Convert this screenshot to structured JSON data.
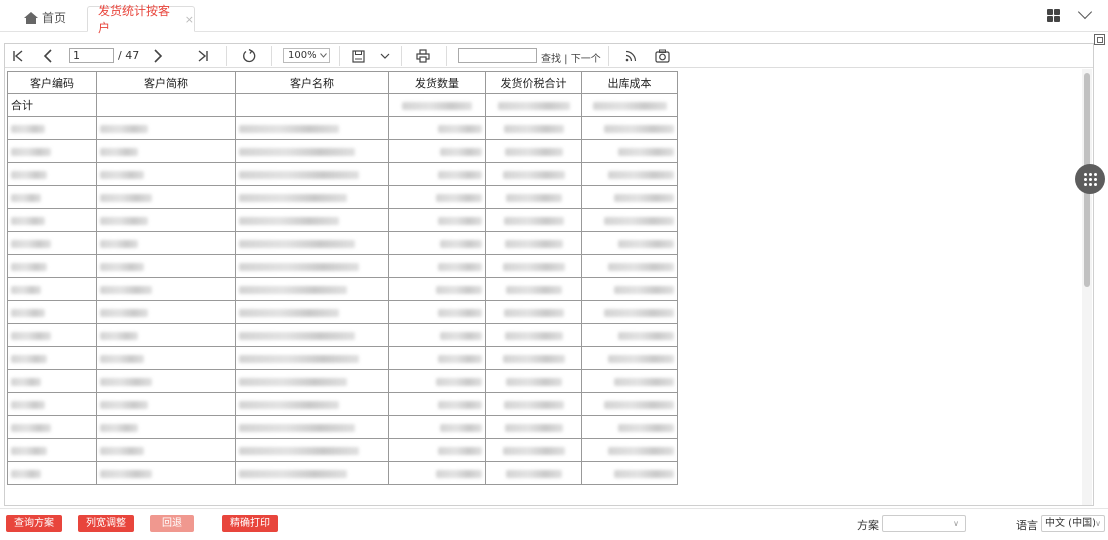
{
  "tabs": {
    "home_label": "首页",
    "active_label": "发货统计按客户",
    "close_glyph": "×"
  },
  "toolbar": {
    "page_current": "1",
    "page_total": "/ 47",
    "zoom": "100%",
    "find_placeholder": "",
    "find_label": "查找 | 下一个",
    "icons": [
      "first-page-icon",
      "prev-page-icon",
      "next-page-icon",
      "last-page-icon",
      "refresh-icon",
      "save-icon",
      "dropdown-icon",
      "print-icon",
      "rss-icon",
      "camera-icon"
    ]
  },
  "table": {
    "headers": [
      "客户编码",
      "客户简称",
      "客户名称",
      "发货数量",
      "发货价税合计",
      "出库成本"
    ],
    "total_label": "合计"
  },
  "bottom": {
    "buttons": [
      "查询方案",
      "列宽调整",
      "回退",
      "精确打印"
    ],
    "scheme_label": "方案",
    "scheme_value": "",
    "language_label": "语言",
    "language_value": "中文 (中国)"
  },
  "colors": {
    "accent": "#e8453c",
    "accent_light": "#f0988f"
  }
}
